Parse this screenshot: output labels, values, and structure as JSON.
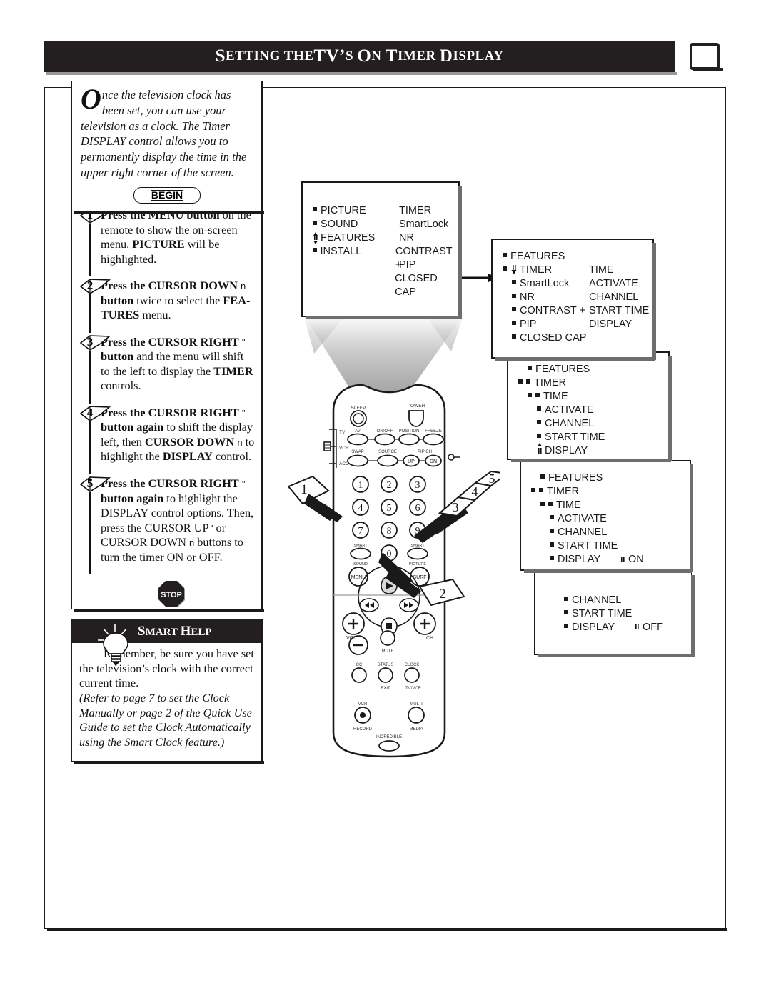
{
  "header": {
    "title_parts": [
      "S",
      "ETTING THE ",
      "TV",
      "’",
      "S ",
      "O",
      "N ",
      "T",
      "IMER ",
      "D",
      "ISPLAY"
    ],
    "title_full": "SETTING THE TV’S ON TIMER DISPLAY",
    "tv_icon": "tv-icon"
  },
  "intro": {
    "dropcap": "O",
    "text": "nce the television clock has been set, you can use your television as a clock. The Timer DISPLAY control allows you to permanently display the time in the upper right corner of the screen.",
    "begin_label": "BEGIN"
  },
  "steps": [
    {
      "number": "1",
      "html": "<b>Press the MENU button</b> on the remote to show the on-screen menu. <b>PICTURE</b> will be highlighted."
    },
    {
      "number": "2",
      "html": "<b>Press the CURSOR DOWN</b> <span class=\"arrowglyph\">n</span> <b>button</b> twice to select the <b>FEA-TURES</b> menu."
    },
    {
      "number": "3",
      "html": "<b>Press the CURSOR RIGHT</b> <span class=\"arrowglyph\">\"</span> <b>button</b> and the menu will shift to the left to display the <b>TIMER</b> controls."
    },
    {
      "number": "4",
      "html": "<b>Press the CURSOR RIGHT</b> <span class=\"arrowglyph\">\"</span> <b>button again</b> to shift the display left, then <b>CURSOR DOWN</b> <span class=\"arrowglyph\">n</span> to highlight the <b>DISPLAY</b> control."
    },
    {
      "number": "5",
      "html": "<b>Press the CURSOR RIGHT</b> <span class=\"arrowglyph\">\"</span> <b>button again</b> to highlight the DISPLAY control options. Then, press the CURSOR UP <span class=\"arrowglyph\">'</span> or CURSOR DOWN <span class=\"arrowglyph\">n</span> buttons to turn the timer ON or OFF."
    }
  ],
  "stop_label": "STOP",
  "smart_help": {
    "title": "SMART HELP",
    "title_parts": [
      "S",
      "MART ",
      "H",
      "ELP"
    ],
    "body_plain": "Remember, be sure you have set the television’s clock with the correct current time.",
    "body_italic": "(Refer to page 7 to set the Clock Manually or page 2 of the Quick Use Guide to set the Clock Automatically using the Smart Clock feature.)"
  },
  "menus": [
    {
      "id": "menu-main",
      "rows": [
        {
          "bullet": "square",
          "colA": "PICTURE",
          "colB": "TIMER"
        },
        {
          "bullet": "square",
          "colA": "SOUND",
          "colB": "SmartLock"
        },
        {
          "bullet": "updown",
          "colA": "FEATURES",
          "colB": "NR"
        },
        {
          "bullet": "square",
          "colA": "INSTALL",
          "colB": "CONTRAST +"
        },
        {
          "bullet": "none",
          "colA": "",
          "colB": "PIP"
        },
        {
          "bullet": "none",
          "colA": "",
          "colB": "CLOSED CAP"
        }
      ]
    },
    {
      "id": "menu-features",
      "rows": [
        {
          "bullet": "square",
          "colA": "FEATURES",
          "colB": ""
        },
        {
          "bullet": "sq-down",
          "colA": "TIMER",
          "colB": "TIME"
        },
        {
          "bullet": "indent1",
          "colA": "SmartLock",
          "colB": "ACTIVATE"
        },
        {
          "bullet": "indent1",
          "colA": "NR",
          "colB": "CHANNEL"
        },
        {
          "bullet": "indent1",
          "colA": "CONTRAST +",
          "colB": "START TIME"
        },
        {
          "bullet": "indent1",
          "colA": "PIP",
          "colB": "DISPLAY"
        },
        {
          "bullet": "indent1",
          "colA": "CLOSED CAP",
          "colB": ""
        }
      ]
    },
    {
      "id": "menu-timer",
      "rows": [
        {
          "bullet": "square",
          "colA": "FEATURES",
          "colB": ""
        },
        {
          "bullet": "sq-sq",
          "colA": "TIMER",
          "colB": ""
        },
        {
          "bullet": "sq-sq2",
          "colA": "TIME",
          "colB": ""
        },
        {
          "bullet": "indent2",
          "colA": "ACTIVATE",
          "colB": ""
        },
        {
          "bullet": "indent2",
          "colA": "CHANNEL",
          "colB": ""
        },
        {
          "bullet": "indent2",
          "colA": "START TIME",
          "colB": ""
        },
        {
          "bullet": "upmark",
          "colA": "DISPLAY",
          "colB": ""
        }
      ]
    },
    {
      "id": "menu-display-on",
      "rows": [
        {
          "bullet": "square",
          "colA": "FEATURES",
          "colB": ""
        },
        {
          "bullet": "sq-sq",
          "colA": "TIMER",
          "colB": ""
        },
        {
          "bullet": "sq-sq2",
          "colA": "TIME",
          "colB": ""
        },
        {
          "bullet": "indent2",
          "colA": "ACTIVATE",
          "colB": ""
        },
        {
          "bullet": "indent2",
          "colA": "CHANNEL",
          "colB": ""
        },
        {
          "bullet": "indent2",
          "colA": "START TIME",
          "colB": ""
        },
        {
          "bullet": "indent2",
          "colA": "DISPLAY",
          "colB": "ON",
          "colBmark": "\""
        }
      ]
    },
    {
      "id": "menu-display-off",
      "rows": [
        {
          "bullet": "indent2",
          "colA": "CHANNEL",
          "colB": ""
        },
        {
          "bullet": "indent2",
          "colA": "START TIME",
          "colB": ""
        },
        {
          "bullet": "indent2",
          "colA": "DISPLAY",
          "colB": "OFF",
          "colBmark": "\""
        }
      ]
    }
  ],
  "callouts": [
    "1",
    "2",
    "3",
    "4",
    "5"
  ],
  "remote": {
    "labels": {
      "sleep": "SLEEP",
      "power": "POWER",
      "tv": "TV",
      "vcr": "VCR",
      "acc": "ACC",
      "av": "AV",
      "onoff": "ON/OFF",
      "position": "POSITION",
      "freeze": "FREEZE",
      "swap": "SWAP",
      "source": "SOURCE",
      "pipch": "PIP CH",
      "up": "UP",
      "dn": "DN",
      "keys": [
        "1",
        "2",
        "3",
        "4",
        "5",
        "6",
        "7",
        "8",
        "9",
        "0"
      ],
      "smart_sound": "SMART SOUND",
      "smart_picture": "SMART PICTURE",
      "menu": "MENU",
      "surf": "SURF",
      "vol": "VOL",
      "ch": "CH",
      "mute": "MUTE",
      "cc": "CC",
      "status": "STATUS",
      "clock": "CLOCK",
      "exit": "EXIT",
      "tvvcr": "TV/VCR",
      "vcr_record": "VCR RECORD",
      "multi_media": "MULTI MEDIA",
      "incredible": "INCREDIBLE"
    }
  },
  "colors": {
    "ink": "#1a1a1a",
    "panel_shadow": "#6e6e70",
    "header_bg": "#231f20",
    "beam": "#bdbdbd"
  }
}
